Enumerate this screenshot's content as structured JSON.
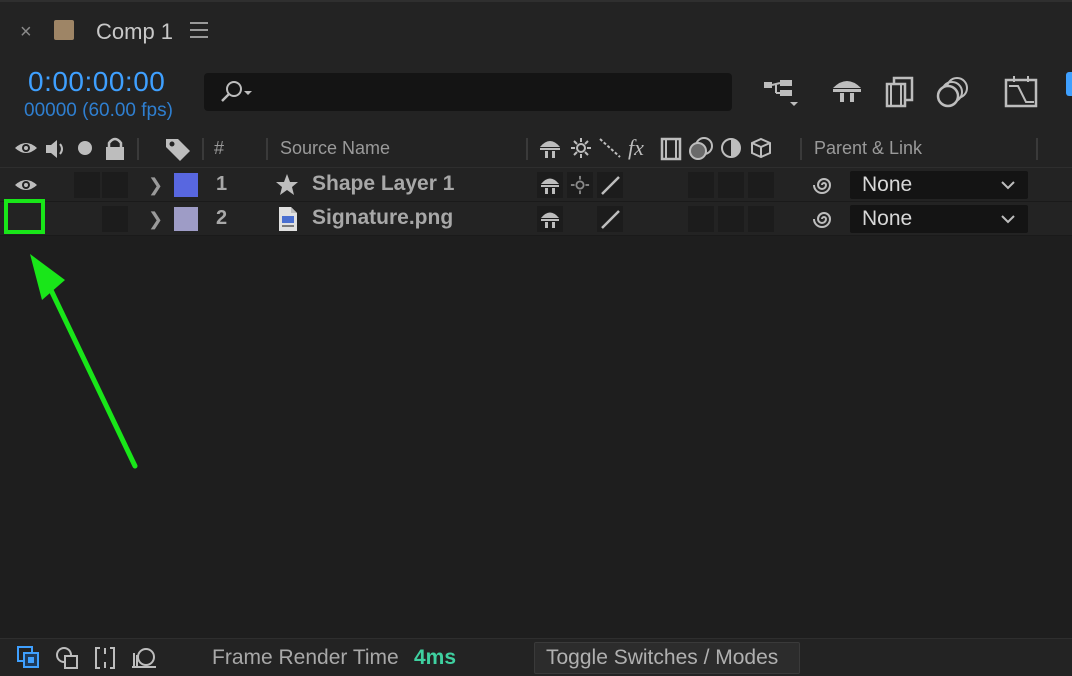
{
  "tab": {
    "close_glyph": "×",
    "title": "Comp 1",
    "swatch_color": "#9e8566"
  },
  "controls": {
    "timecode": "0:00:00:00",
    "frames": "00000 (60.00 fps)",
    "search_placeholder": "",
    "icons": [
      "composition-flowchart-icon",
      "draft-3d-icon",
      "frame-blending-icon",
      "motion-blur-icon",
      "graph-editor-icon"
    ]
  },
  "columns": {
    "number": "#",
    "source_name": "Source Name",
    "parent": "Parent & Link"
  },
  "layers": [
    {
      "index": "1",
      "name": "Shape Layer 1",
      "type_icon": "star-icon",
      "label_color": "#5867e0",
      "visible": true,
      "parent": "None"
    },
    {
      "index": "2",
      "name": "Signature.png",
      "type_icon": "image-file-icon",
      "label_color": "#9e9cc6",
      "visible": false,
      "parent": "None"
    }
  ],
  "annotation": {
    "color": "#19e619"
  },
  "footer": {
    "frame_render_label": "Frame Render Time",
    "frame_render_value": "4ms",
    "toggle_label": "Toggle Switches / Modes"
  }
}
